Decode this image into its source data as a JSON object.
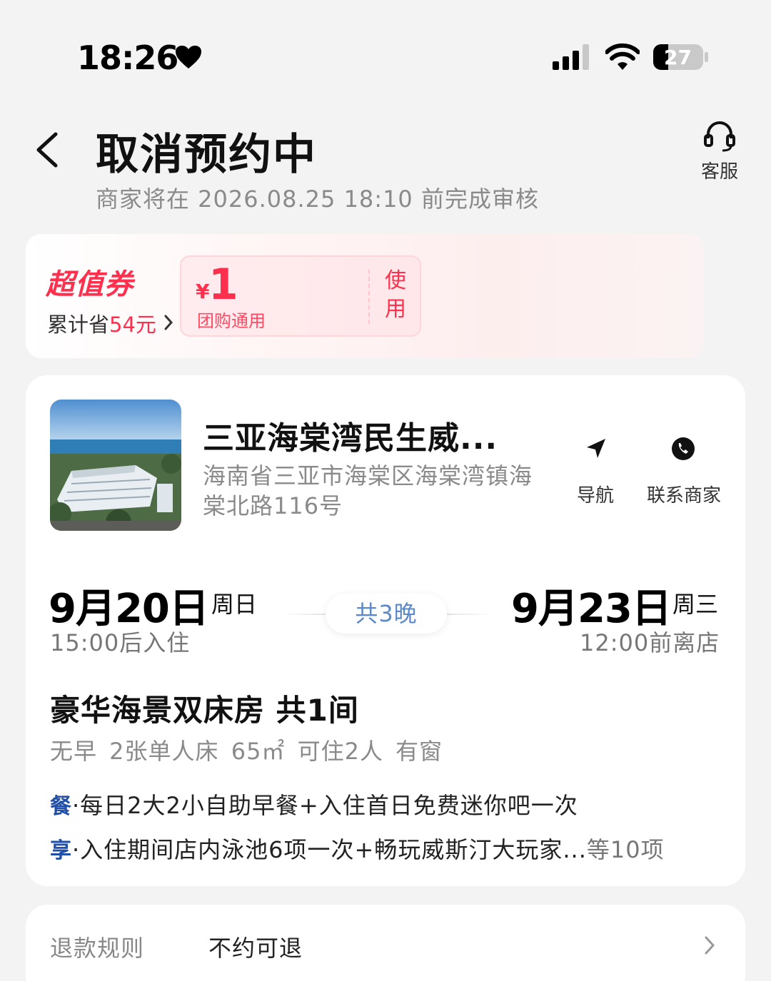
{
  "status_bar": {
    "time": "18:26",
    "battery": "27"
  },
  "header": {
    "title": "取消预约中",
    "subtitle": "商家将在 2026.08.25 18:10 前完成审核",
    "customer_service_label": "客服"
  },
  "coupon": {
    "brand": "超值券",
    "saved_prefix": "累计省",
    "saved_amount": "54元",
    "currency": "¥",
    "price": "1",
    "description": "团购通用",
    "use_label": "使用",
    "accent_color": "#ff2f4e"
  },
  "hotel": {
    "name": "三亚海棠湾民生威...",
    "address": "海南省三亚市海棠区海棠湾镇海棠北路116号",
    "nav_label": "导航",
    "contact_label": "联系商家"
  },
  "stay": {
    "check_in_date": "9月20日",
    "check_in_weekday": "周日",
    "check_in_time": "15:00后入住",
    "nights": "共3晚",
    "check_out_date": "9月23日",
    "check_out_weekday": "周三",
    "check_out_time": "12:00前离店"
  },
  "room": {
    "title": "豪华海景双床房 共1间",
    "specs": "无早  2张单人床  65㎡  可住2人  有窗"
  },
  "perks": [
    {
      "tag": "餐",
      "text": "·每日2大2小自助早餐+入住首日免费迷你吧一次",
      "more": ""
    },
    {
      "tag": "享",
      "text": "·入住期间店内泳池6项一次+畅玩威斯汀大玩家...",
      "more": "等10项"
    }
  ],
  "refund": {
    "label": "退款规则",
    "value": "不约可退"
  }
}
